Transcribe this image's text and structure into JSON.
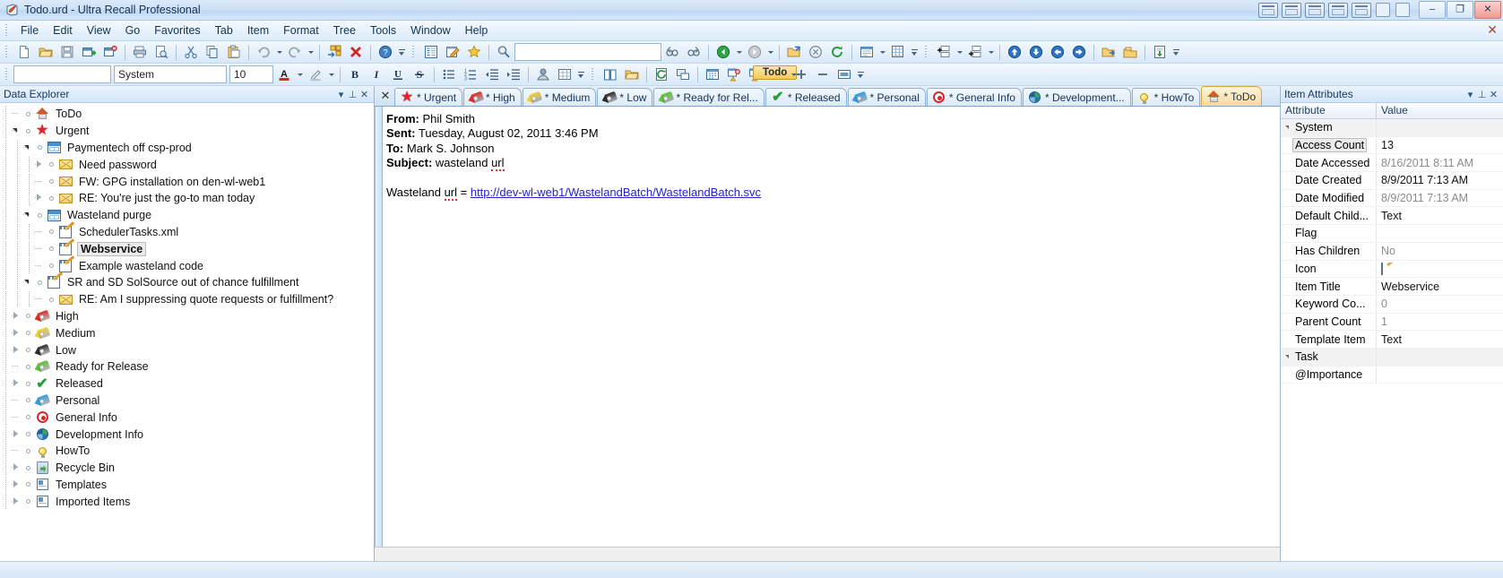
{
  "window": {
    "title": "Todo.urd - Ultra Recall Professional",
    "app_icon": "book-feather-icon",
    "buttons": {
      "minimize": "–",
      "maximize": "❐",
      "close": "✕"
    }
  },
  "menu": {
    "items": [
      "File",
      "Edit",
      "View",
      "Go",
      "Favorites",
      "Tab",
      "Item",
      "Format",
      "Tree",
      "Tools",
      "Window",
      "Help"
    ],
    "close_label": "✕"
  },
  "toolbar_main": {
    "search_value": "",
    "items": [
      "new-document",
      "open-folder",
      "save",
      "new-item",
      "delete-item",
      "print",
      "print-preview",
      "cut",
      "copy",
      "paste",
      "undo",
      "redo",
      "arrange",
      "delete-red-x",
      "help"
    ]
  },
  "toolbar_nav": {
    "items": [
      "outline",
      "edit-note",
      "favorites-star",
      "search-magnifier",
      "find-prev",
      "find-next",
      "back",
      "forward",
      "open-external",
      "cancel",
      "refresh",
      "view-mode",
      "grid-view"
    ]
  },
  "toolbar_tree": {
    "items": [
      "insert-child",
      "insert-sibling",
      "move-up",
      "move-down",
      "move-left",
      "move-right",
      "import",
      "export",
      "archive"
    ]
  },
  "toolbar_format": {
    "style_value": "",
    "font_value": "System",
    "size_value": "10",
    "buttons": [
      "font-color",
      "highlight",
      "bold",
      "italic",
      "underline",
      "strikethrough",
      "bullet-list",
      "number-list",
      "outdent",
      "indent",
      "insert-image",
      "insert-table",
      "dictionary",
      "folder-open",
      "refresh-doc",
      "screen-capture",
      "calendar",
      "reminder-add",
      "reminder-edit",
      "zoom-in",
      "zoom-out",
      "full-screen"
    ],
    "todo_chip": "Todo"
  },
  "data_explorer": {
    "title": "Data Explorer",
    "header_icons": [
      "chevron-down-icon",
      "pin-icon",
      "close-icon"
    ],
    "nodes": [
      {
        "label": "ToDo",
        "icon": "home",
        "depth": 0,
        "expander": "none",
        "dot": true
      },
      {
        "label": "Urgent",
        "icon": "star",
        "depth": 0,
        "expander": "open",
        "dot": true
      },
      {
        "label": "Paymentech off csp-prod",
        "icon": "grid",
        "depth": 1,
        "expander": "open",
        "dot": true
      },
      {
        "label": "Need password",
        "icon": "envelope",
        "depth": 2,
        "expander": "shut",
        "dot": true
      },
      {
        "label": "FW: GPG installation on den-wl-web1",
        "icon": "envelope",
        "depth": 2,
        "expander": "none",
        "dot": true
      },
      {
        "label": "RE: You're just the go-to man today",
        "icon": "envelope",
        "depth": 2,
        "expander": "shut",
        "dot": true
      },
      {
        "label": "Wasteland purge",
        "icon": "grid",
        "depth": 1,
        "expander": "open",
        "dot": true
      },
      {
        "label": "SchedulerTasks.xml",
        "icon": "note",
        "depth": 2,
        "expander": "none",
        "dot": true
      },
      {
        "label": "Webservice",
        "icon": "note",
        "depth": 2,
        "expander": "none",
        "dot": true,
        "selected": true
      },
      {
        "label": "Example wasteland code",
        "icon": "note",
        "depth": 2,
        "expander": "none",
        "dot": true
      },
      {
        "label": "SR and SD SolSource out of chance fulfillment",
        "icon": "note",
        "depth": 1,
        "expander": "open",
        "dot": true
      },
      {
        "label": "RE: Am I suppressing quote requests or fulfillment?",
        "icon": "envelope",
        "depth": 2,
        "expander": "none",
        "dot": true
      },
      {
        "label": "High",
        "icon": "tag-red",
        "depth": 0,
        "expander": "shut",
        "dot": true
      },
      {
        "label": "Medium",
        "icon": "tag-yellow",
        "depth": 0,
        "expander": "shut",
        "dot": true
      },
      {
        "label": "Low",
        "icon": "tag-black",
        "depth": 0,
        "expander": "shut",
        "dot": true
      },
      {
        "label": "Ready for Release",
        "icon": "tag-green",
        "depth": 0,
        "expander": "none",
        "dot": true
      },
      {
        "label": "Released",
        "icon": "check",
        "depth": 0,
        "expander": "shut",
        "dot": true
      },
      {
        "label": "Personal",
        "icon": "tag-blue",
        "depth": 0,
        "expander": "none",
        "dot": true
      },
      {
        "label": "General Info",
        "icon": "target",
        "depth": 0,
        "expander": "none",
        "dot": true
      },
      {
        "label": "Development Info",
        "icon": "globe",
        "depth": 0,
        "expander": "shut",
        "dot": true
      },
      {
        "label": "HowTo",
        "icon": "bulb",
        "depth": 0,
        "expander": "none",
        "dot": true
      },
      {
        "label": "Recycle Bin",
        "icon": "recycle",
        "depth": 0,
        "expander": "shut",
        "dot": true
      },
      {
        "label": "Templates",
        "icon": "template",
        "depth": 0,
        "expander": "shut",
        "dot": true
      },
      {
        "label": "Imported Items",
        "icon": "template",
        "depth": 0,
        "expander": "shut",
        "dot": true
      }
    ]
  },
  "tabs": {
    "close_label": "✕",
    "items": [
      {
        "label": "* Urgent",
        "icon": "star"
      },
      {
        "label": "* High",
        "icon": "tag-red"
      },
      {
        "label": "* Medium",
        "icon": "tag-yellow"
      },
      {
        "label": "* Low",
        "icon": "tag-black"
      },
      {
        "label": "* Ready for Rel...",
        "icon": "tag-green"
      },
      {
        "label": "* Released",
        "icon": "check"
      },
      {
        "label": "* Personal",
        "icon": "tag-blue"
      },
      {
        "label": "* General Info",
        "icon": "target"
      },
      {
        "label": "* Development...",
        "icon": "globe"
      },
      {
        "label": "* HowTo",
        "icon": "bulb"
      },
      {
        "label": "* ToDo",
        "icon": "home",
        "active": true
      }
    ]
  },
  "editor": {
    "from_label": "From:",
    "from_value": "Phil Smith",
    "sent_label": "Sent:",
    "sent_value": "Tuesday, August 02, 2011 3:46 PM",
    "to_label": "To:",
    "to_value": "Mark S. Johnson",
    "subject_label": "Subject:",
    "subject_value": "wasteland url",
    "body_prefix": "Wasteland url = ",
    "body_link": "http://dev-wl-web1/WastelandBatch/WastelandBatch.svc"
  },
  "item_attributes": {
    "title": "Item Attributes",
    "header_icons": [
      "chevron-down-icon",
      "pin-icon",
      "close-icon"
    ],
    "columns": [
      "Attribute",
      "Value"
    ],
    "rows": [
      {
        "name": "System",
        "value": "",
        "group": true
      },
      {
        "name": "Access Count",
        "value": "13",
        "selected": true
      },
      {
        "name": "Date Accessed",
        "value": "8/16/2011 8:11 AM",
        "dim": true
      },
      {
        "name": "Date Created",
        "value": "8/9/2011 7:13 AM"
      },
      {
        "name": "Date Modified",
        "value": "8/9/2011 7:13 AM",
        "dim": true
      },
      {
        "name": "Default Child...",
        "value": "Text"
      },
      {
        "name": "Flag",
        "value": ""
      },
      {
        "name": "Has Children",
        "value": "No",
        "dim": true
      },
      {
        "name": "Icon",
        "value": "",
        "icon": "note"
      },
      {
        "name": "Item Title",
        "value": "Webservice"
      },
      {
        "name": "Keyword Co...",
        "value": "0",
        "dim": true
      },
      {
        "name": "Parent Count",
        "value": "1",
        "dim": true
      },
      {
        "name": "Template Item",
        "value": "Text"
      },
      {
        "name": "Task",
        "value": "",
        "group": true
      },
      {
        "name": "@Importance",
        "value": ""
      }
    ]
  }
}
